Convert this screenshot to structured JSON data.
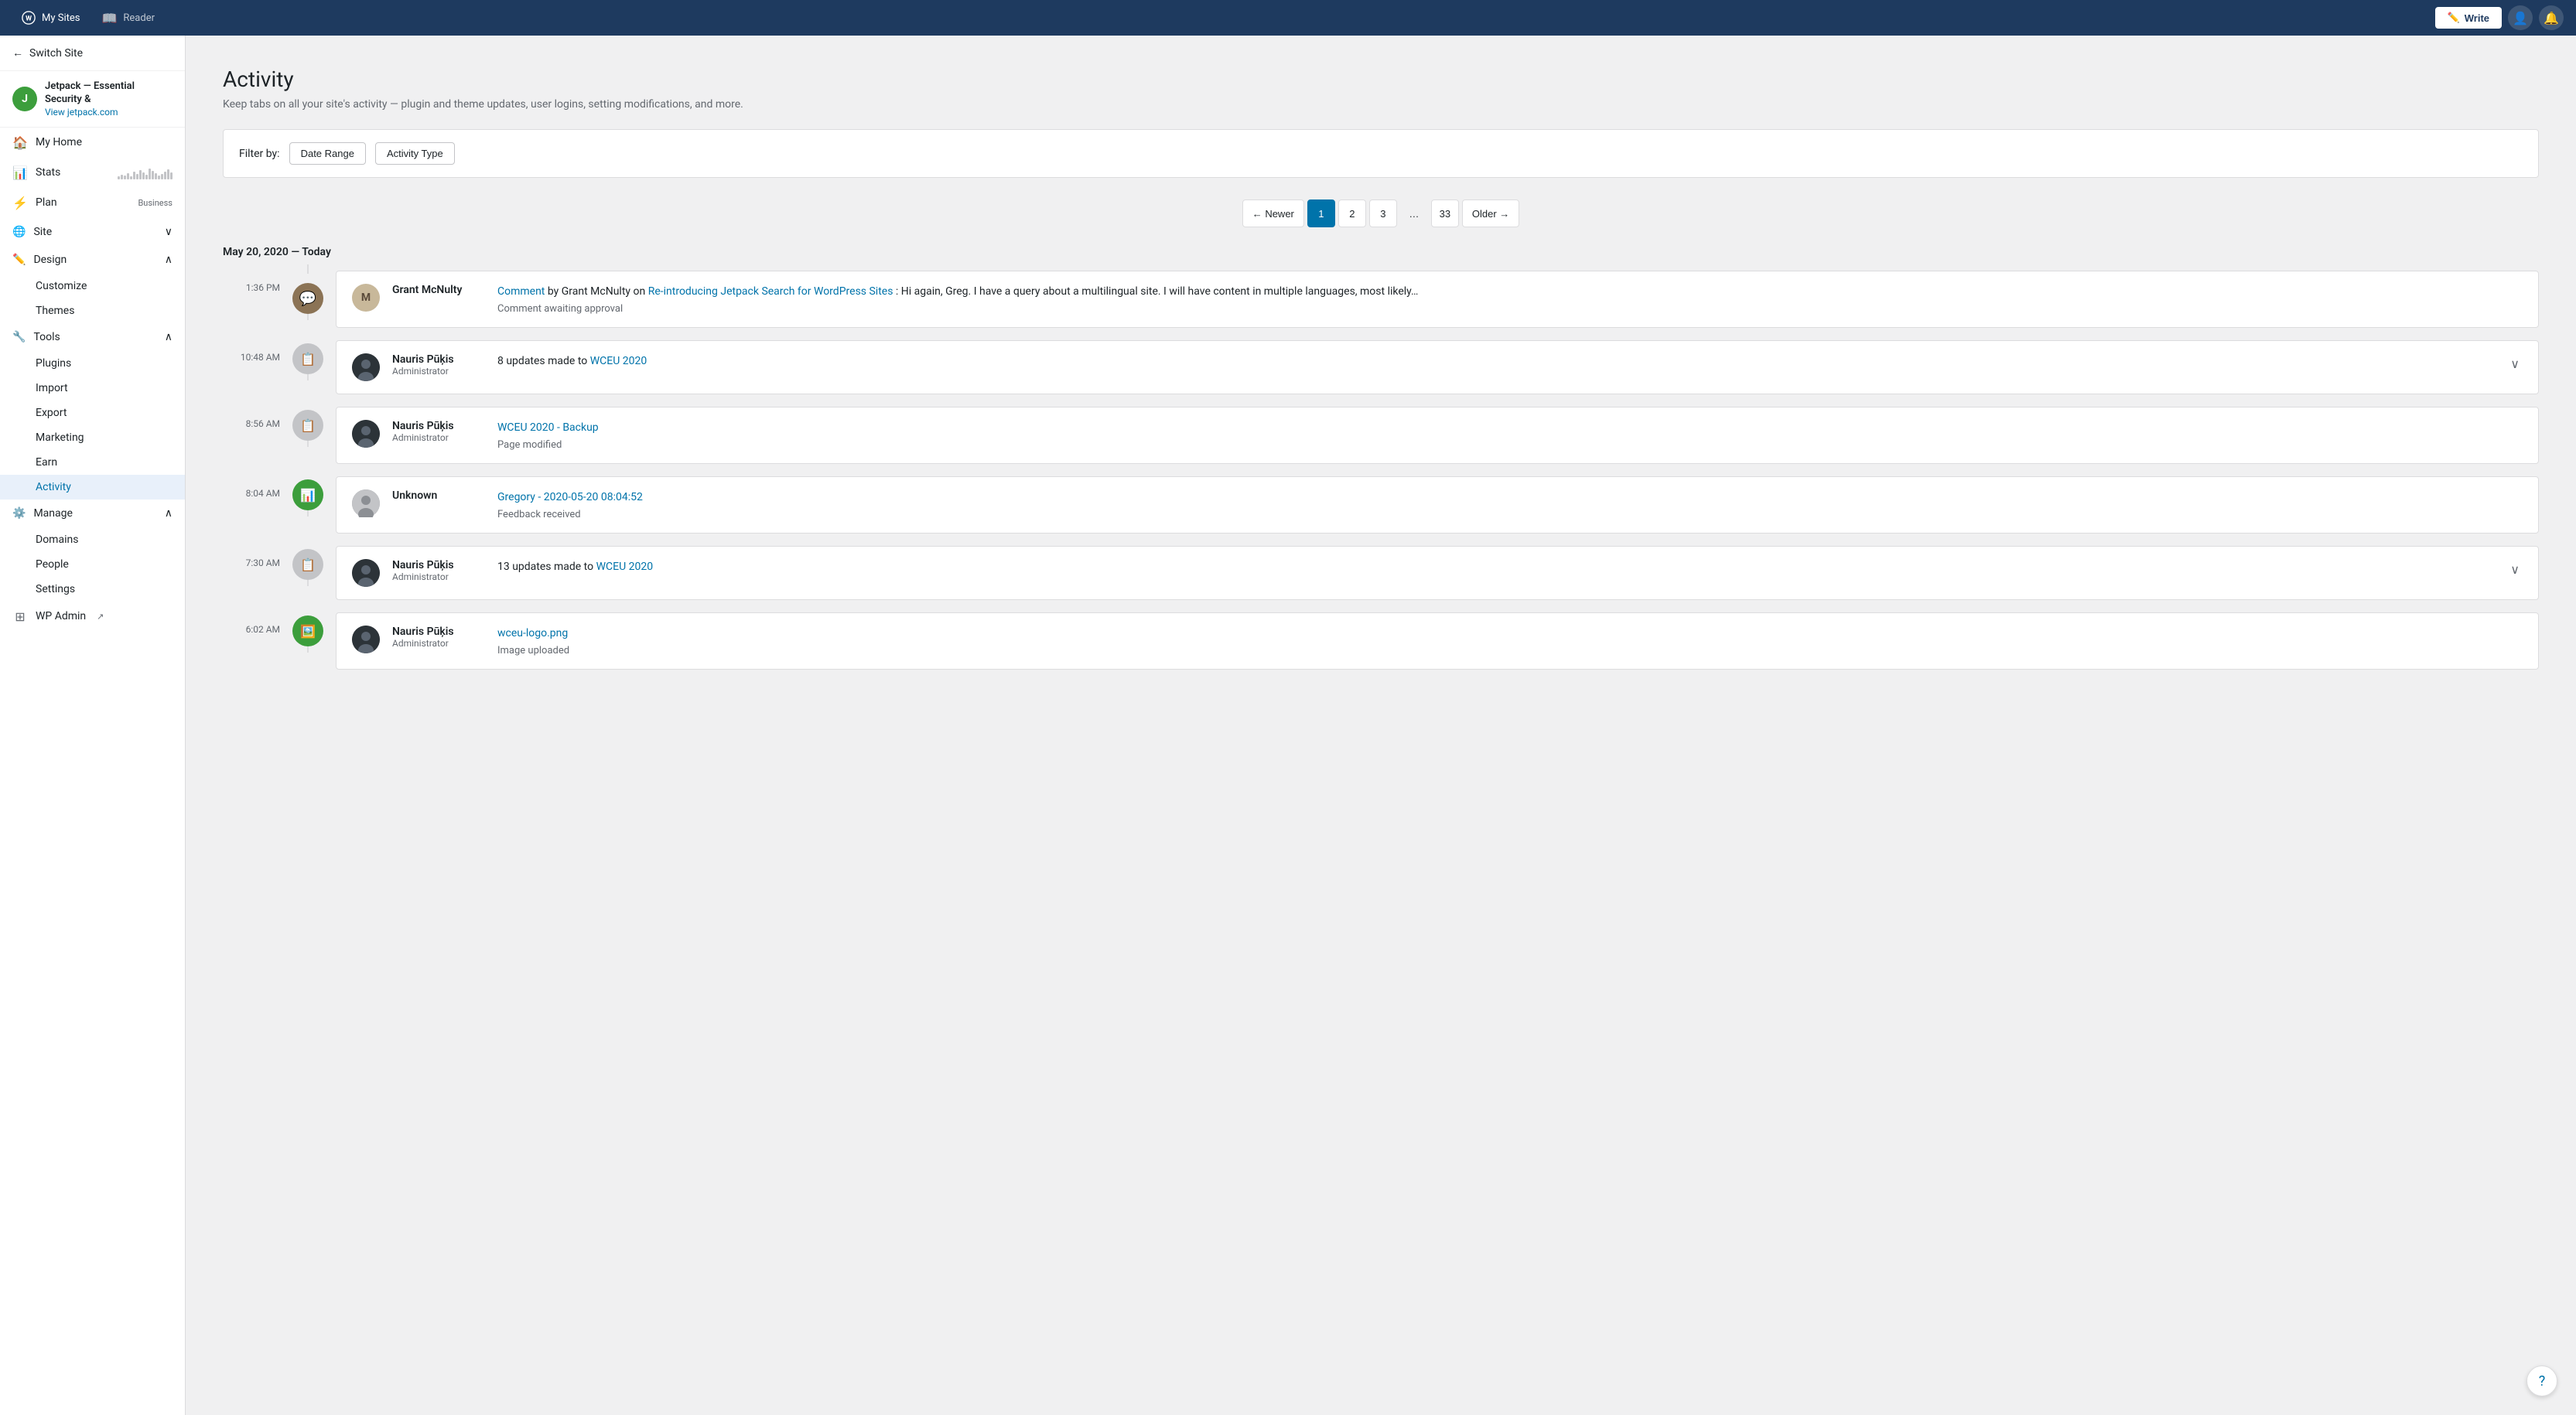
{
  "topnav": {
    "brand": "My Sites",
    "reader": "Reader",
    "write_label": "Write"
  },
  "sidebar": {
    "switch_site": "Switch Site",
    "site_name": "Jetpack — Essential Security &",
    "site_url": "View jetpack.com",
    "nav_items": [
      {
        "id": "my-home",
        "label": "My Home",
        "icon": "🏠"
      },
      {
        "id": "stats",
        "label": "Stats",
        "icon": "📊"
      },
      {
        "id": "plan",
        "label": "Plan",
        "icon": "⚡",
        "badge": "Business"
      },
      {
        "id": "site",
        "label": "Site",
        "icon": "🌐",
        "expandable": true
      },
      {
        "id": "design",
        "label": "Design",
        "icon": "✏️",
        "expanded": true
      },
      {
        "id": "tools",
        "label": "Tools",
        "icon": "🔧",
        "expanded": true
      },
      {
        "id": "manage",
        "label": "Manage",
        "icon": "⚙️",
        "expanded": true
      },
      {
        "id": "wp-admin",
        "label": "WP Admin",
        "icon": "⊞"
      }
    ],
    "design_sub": [
      "Customize",
      "Themes"
    ],
    "tools_sub": [
      "Plugins",
      "Import",
      "Export",
      "Marketing",
      "Earn",
      "Activity"
    ],
    "manage_sub": [
      "Domains",
      "People",
      "Settings"
    ]
  },
  "page": {
    "title": "Activity",
    "description": "Keep tabs on all your site's activity — plugin and theme updates, user logins, setting modifications, and more."
  },
  "filters": {
    "label": "Filter by:",
    "date_range": "Date Range",
    "activity_type": "Activity Type"
  },
  "pagination": {
    "newer": "← Newer",
    "older": "Older →",
    "pages": [
      "1",
      "2",
      "3",
      "...",
      "33"
    ],
    "active": "1"
  },
  "date_group": "May 20, 2020 — Today",
  "activities": [
    {
      "time": "1:36 PM",
      "icon_type": "comment",
      "user": "Grant McNulty",
      "role": "",
      "link_text": "Comment",
      "link_pre": "",
      "link_url": "#",
      "link2_text": "Re-introducing Jetpack Search for WordPress Sites",
      "link2_url": "#",
      "text_after": ": Hi again, Greg. I have a query about a multilingual site. I will have content in multiple languages, most likely…",
      "sub": "Comment awaiting approval",
      "has_avatar": false,
      "expandable": false
    },
    {
      "time": "10:48 AM",
      "icon_type": "update",
      "user": "Nauris Pūķis",
      "role": "Administrator",
      "link_text": "",
      "text": "8 updates made to ",
      "link_main": "WCEU 2020",
      "link_main_url": "#",
      "sub": "",
      "has_avatar": true,
      "expandable": true
    },
    {
      "time": "8:56 AM",
      "icon_type": "backup",
      "user": "Nauris Pūķis",
      "role": "Administrator",
      "link_text": "WCEU 2020 - Backup",
      "link_url": "#",
      "sub": "Page modified",
      "has_avatar": true,
      "expandable": false
    },
    {
      "time": "8:04 AM",
      "icon_type": "feedback",
      "user": "Unknown",
      "role": "",
      "link_text": "Gregory - 2020-05-20 08:04:52",
      "link_url": "#",
      "sub": "Feedback received",
      "has_avatar": false,
      "expandable": false
    },
    {
      "time": "7:30 AM",
      "icon_type": "update",
      "user": "Nauris Pūķis",
      "role": "Administrator",
      "text": "13 updates made to ",
      "link_main": "WCEU 2020",
      "link_main_url": "#",
      "sub": "",
      "has_avatar": true,
      "expandable": true
    },
    {
      "time": "6:02 AM",
      "icon_type": "image",
      "user": "Nauris Pūķis",
      "role": "Administrator",
      "link_text": "wceu-logo.png",
      "link_url": "#",
      "sub": "Image uploaded",
      "has_avatar": true,
      "expandable": false
    }
  ]
}
